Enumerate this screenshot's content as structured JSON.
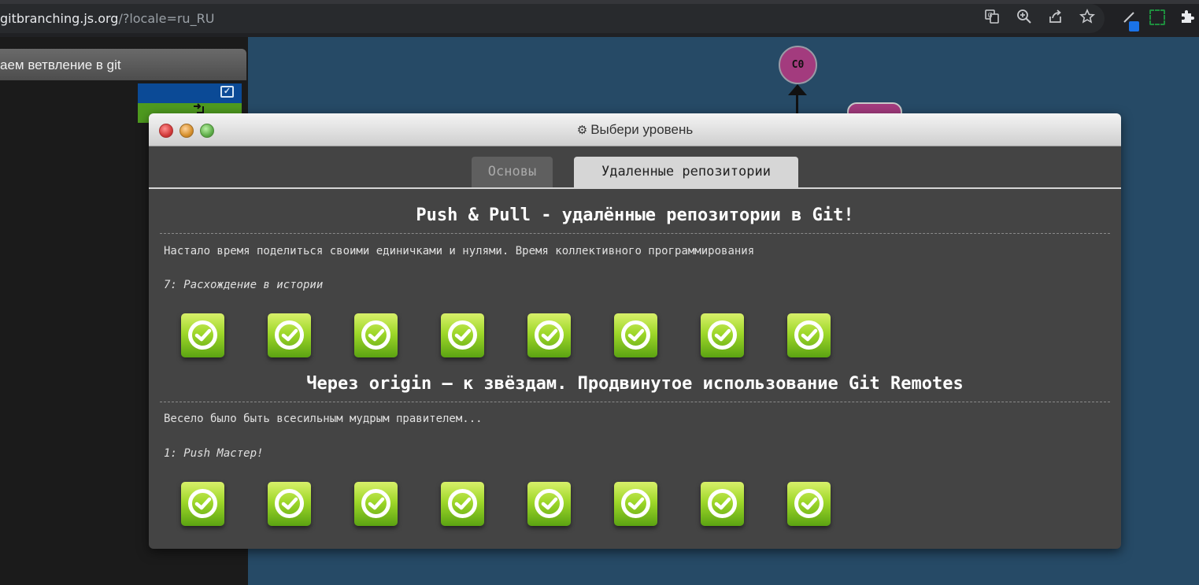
{
  "browser": {
    "url_host": "gitbranching.js.org",
    "url_rest": "/?locale=ru_RU"
  },
  "sidebar": {
    "title": "аем ветвление в git"
  },
  "tree": {
    "commit_label": "C0"
  },
  "modal": {
    "title": "Выбери уровень",
    "tabs": [
      {
        "label": "Основы",
        "active": false
      },
      {
        "label": "Удаленные репозитории",
        "active": true
      }
    ],
    "sections": [
      {
        "title": "Push & Pull - удалённые репозитории в Git!",
        "description": "Настало время поделиться своими единичками и нулями. Время коллективного программирования",
        "level_label": "7: Расхождение в истории",
        "levels_completed": 8
      },
      {
        "title": "Через origin – к звёздам. Продвинутое использование Git Remotes",
        "description": "Весело было быть всесильным мудрым правителем...",
        "level_label": "1: Push Мастер!",
        "levels_completed": 8
      }
    ]
  },
  "colors": {
    "background": "#264a66",
    "level_complete": "#9fd82a",
    "commit": "#a33b7e"
  }
}
